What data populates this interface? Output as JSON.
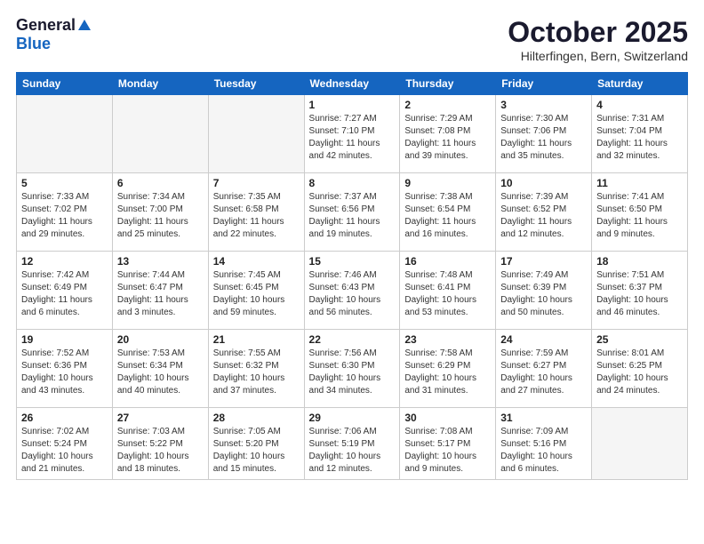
{
  "logo": {
    "general": "General",
    "blue": "Blue"
  },
  "title": "October 2025",
  "location": "Hilterfingen, Bern, Switzerland",
  "days_of_week": [
    "Sunday",
    "Monday",
    "Tuesday",
    "Wednesday",
    "Thursday",
    "Friday",
    "Saturday"
  ],
  "weeks": [
    [
      {
        "day": "",
        "info": ""
      },
      {
        "day": "",
        "info": ""
      },
      {
        "day": "",
        "info": ""
      },
      {
        "day": "1",
        "info": "Sunrise: 7:27 AM\nSunset: 7:10 PM\nDaylight: 11 hours\nand 42 minutes."
      },
      {
        "day": "2",
        "info": "Sunrise: 7:29 AM\nSunset: 7:08 PM\nDaylight: 11 hours\nand 39 minutes."
      },
      {
        "day": "3",
        "info": "Sunrise: 7:30 AM\nSunset: 7:06 PM\nDaylight: 11 hours\nand 35 minutes."
      },
      {
        "day": "4",
        "info": "Sunrise: 7:31 AM\nSunset: 7:04 PM\nDaylight: 11 hours\nand 32 minutes."
      }
    ],
    [
      {
        "day": "5",
        "info": "Sunrise: 7:33 AM\nSunset: 7:02 PM\nDaylight: 11 hours\nand 29 minutes."
      },
      {
        "day": "6",
        "info": "Sunrise: 7:34 AM\nSunset: 7:00 PM\nDaylight: 11 hours\nand 25 minutes."
      },
      {
        "day": "7",
        "info": "Sunrise: 7:35 AM\nSunset: 6:58 PM\nDaylight: 11 hours\nand 22 minutes."
      },
      {
        "day": "8",
        "info": "Sunrise: 7:37 AM\nSunset: 6:56 PM\nDaylight: 11 hours\nand 19 minutes."
      },
      {
        "day": "9",
        "info": "Sunrise: 7:38 AM\nSunset: 6:54 PM\nDaylight: 11 hours\nand 16 minutes."
      },
      {
        "day": "10",
        "info": "Sunrise: 7:39 AM\nSunset: 6:52 PM\nDaylight: 11 hours\nand 12 minutes."
      },
      {
        "day": "11",
        "info": "Sunrise: 7:41 AM\nSunset: 6:50 PM\nDaylight: 11 hours\nand 9 minutes."
      }
    ],
    [
      {
        "day": "12",
        "info": "Sunrise: 7:42 AM\nSunset: 6:49 PM\nDaylight: 11 hours\nand 6 minutes."
      },
      {
        "day": "13",
        "info": "Sunrise: 7:44 AM\nSunset: 6:47 PM\nDaylight: 11 hours\nand 3 minutes."
      },
      {
        "day": "14",
        "info": "Sunrise: 7:45 AM\nSunset: 6:45 PM\nDaylight: 10 hours\nand 59 minutes."
      },
      {
        "day": "15",
        "info": "Sunrise: 7:46 AM\nSunset: 6:43 PM\nDaylight: 10 hours\nand 56 minutes."
      },
      {
        "day": "16",
        "info": "Sunrise: 7:48 AM\nSunset: 6:41 PM\nDaylight: 10 hours\nand 53 minutes."
      },
      {
        "day": "17",
        "info": "Sunrise: 7:49 AM\nSunset: 6:39 PM\nDaylight: 10 hours\nand 50 minutes."
      },
      {
        "day": "18",
        "info": "Sunrise: 7:51 AM\nSunset: 6:37 PM\nDaylight: 10 hours\nand 46 minutes."
      }
    ],
    [
      {
        "day": "19",
        "info": "Sunrise: 7:52 AM\nSunset: 6:36 PM\nDaylight: 10 hours\nand 43 minutes."
      },
      {
        "day": "20",
        "info": "Sunrise: 7:53 AM\nSunset: 6:34 PM\nDaylight: 10 hours\nand 40 minutes."
      },
      {
        "day": "21",
        "info": "Sunrise: 7:55 AM\nSunset: 6:32 PM\nDaylight: 10 hours\nand 37 minutes."
      },
      {
        "day": "22",
        "info": "Sunrise: 7:56 AM\nSunset: 6:30 PM\nDaylight: 10 hours\nand 34 minutes."
      },
      {
        "day": "23",
        "info": "Sunrise: 7:58 AM\nSunset: 6:29 PM\nDaylight: 10 hours\nand 31 minutes."
      },
      {
        "day": "24",
        "info": "Sunrise: 7:59 AM\nSunset: 6:27 PM\nDaylight: 10 hours\nand 27 minutes."
      },
      {
        "day": "25",
        "info": "Sunrise: 8:01 AM\nSunset: 6:25 PM\nDaylight: 10 hours\nand 24 minutes."
      }
    ],
    [
      {
        "day": "26",
        "info": "Sunrise: 7:02 AM\nSunset: 5:24 PM\nDaylight: 10 hours\nand 21 minutes."
      },
      {
        "day": "27",
        "info": "Sunrise: 7:03 AM\nSunset: 5:22 PM\nDaylight: 10 hours\nand 18 minutes."
      },
      {
        "day": "28",
        "info": "Sunrise: 7:05 AM\nSunset: 5:20 PM\nDaylight: 10 hours\nand 15 minutes."
      },
      {
        "day": "29",
        "info": "Sunrise: 7:06 AM\nSunset: 5:19 PM\nDaylight: 10 hours\nand 12 minutes."
      },
      {
        "day": "30",
        "info": "Sunrise: 7:08 AM\nSunset: 5:17 PM\nDaylight: 10 hours\nand 9 minutes."
      },
      {
        "day": "31",
        "info": "Sunrise: 7:09 AM\nSunset: 5:16 PM\nDaylight: 10 hours\nand 6 minutes."
      },
      {
        "day": "",
        "info": ""
      }
    ]
  ]
}
